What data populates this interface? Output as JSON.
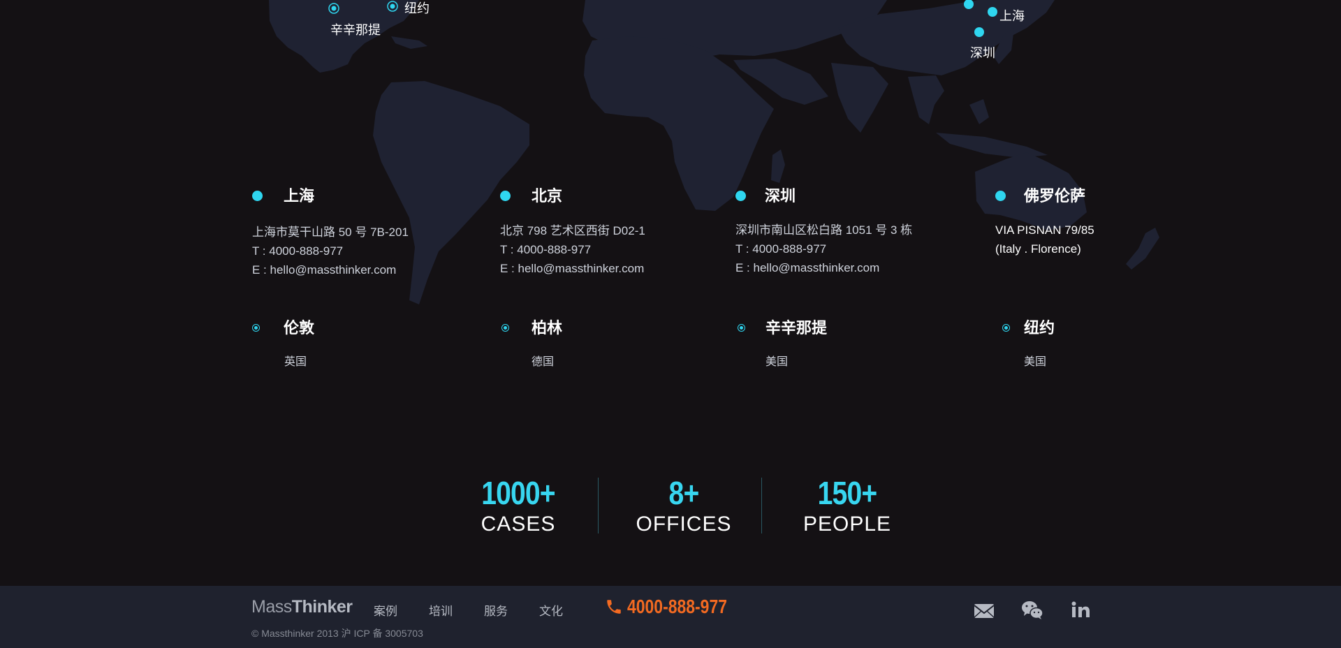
{
  "map": {
    "labels": [
      {
        "id": "cincinnati",
        "text": "辛辛那提"
      },
      {
        "id": "newyork",
        "text": "纽约"
      },
      {
        "id": "shanghai",
        "text": "上海"
      },
      {
        "id": "shenzhen",
        "text": "深圳"
      }
    ]
  },
  "offices": [
    {
      "city": "上海",
      "lines": [
        "上海市莫干山路 50 号 7B-201",
        "T : 4000-888-977",
        "E : hello@massthinker.com"
      ]
    },
    {
      "city": "北京",
      "lines": [
        "北京 798 艺术区西街 D02-1",
        "T : 4000-888-977",
        "E : hello@massthinker.com"
      ]
    },
    {
      "city": "深圳",
      "lines": [
        "深圳市南山区松白路 1051 号 3 栋",
        "T : 4000-888-977",
        "E : hello@massthinker.com"
      ]
    },
    {
      "city": "佛罗伦萨",
      "lines": [
        "VIA PISNAN 79/85",
        "(Italy . Florence)"
      ]
    }
  ],
  "minor_offices": [
    {
      "city": "伦敦",
      "country": "英国"
    },
    {
      "city": "柏林",
      "country": "德国"
    },
    {
      "city": "辛辛那提",
      "country": "美国"
    },
    {
      "city": "纽约",
      "country": "美国"
    }
  ],
  "stats": [
    {
      "value": "1000+",
      "label": "CASES"
    },
    {
      "value": "8+",
      "label": "OFFICES"
    },
    {
      "value": "150+",
      "label": "PEOPLE"
    }
  ],
  "footer": {
    "logo_light": "Mass",
    "logo_bold": "Thinker",
    "nav": [
      "案例",
      "培训",
      "服务",
      "文化"
    ],
    "phone": "4000-888-977",
    "copyright": "© Massthinker 2013 沪 ICP 备 3005703",
    "social": [
      "mail-icon",
      "wechat-icon",
      "linkedin-icon"
    ]
  },
  "colors": {
    "accent": "#2fd6f0",
    "phone": "#f36a21",
    "background": "#141114",
    "footer": "#1f222e",
    "land": "#1f2232"
  }
}
